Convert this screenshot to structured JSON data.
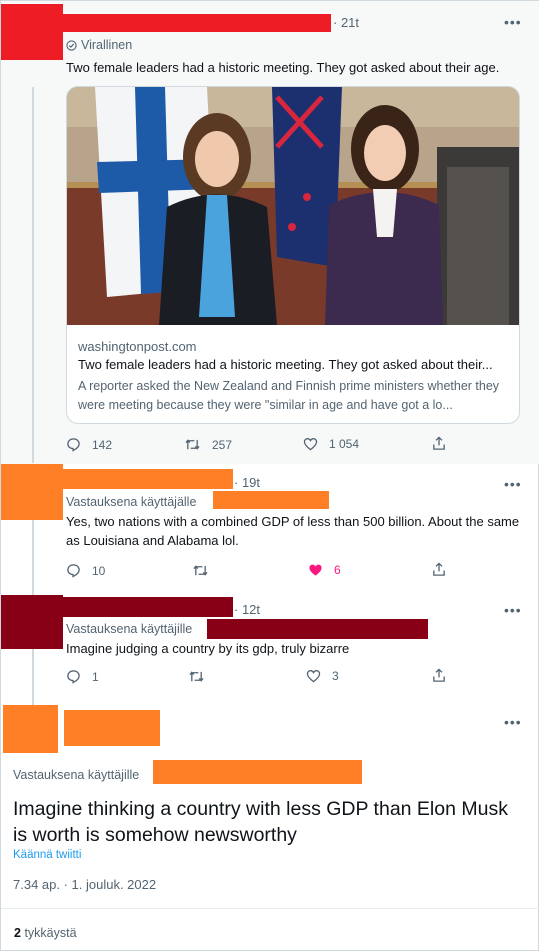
{
  "tweet_main": {
    "time": "· 21t",
    "official_label": "Virallinen",
    "text": "Two female leaders had a historic meeting. They got asked about their age.",
    "card": {
      "domain": "washingtonpost.com",
      "title": "Two female leaders had a historic meeting. They got asked about their...",
      "description": "A reporter asked the New Zealand and Finnish prime ministers whether they were meeting because they were \"similar in age and have got a lo..."
    },
    "replies": "142",
    "retweets": "257",
    "likes": "1 054"
  },
  "reply1": {
    "time": "· 19t",
    "reply_label": "Vastauksena käyttäjälle",
    "text": "Yes, two nations with a combined GDP of less than 500 billion. About the same as Louisiana and Alabama lol.",
    "replies": "10",
    "likes": "6"
  },
  "reply2": {
    "time": "· 12t",
    "reply_label": "Vastauksena käyttäjille",
    "text": "Imagine judging a country by its gdp, truly bizarre",
    "replies": "1",
    "likes": "3"
  },
  "focus_tweet": {
    "reply_label": "Vastauksena käyttäjille",
    "text": "Imagine thinking a country with less GDP than Elon Musk is worth is somehow newsworthy",
    "translate": "Käännä twiitti",
    "date": "7.34 ap. · 1. jouluk. 2022",
    "likes_count": "2",
    "likes_label": "tykkäystä"
  },
  "colors": {
    "redact_red": "#ee1c25",
    "redact_orange": "#ff7f27",
    "redact_maroon": "#880015",
    "like_pink": "#f91880",
    "link_blue": "#1d9bf0"
  }
}
